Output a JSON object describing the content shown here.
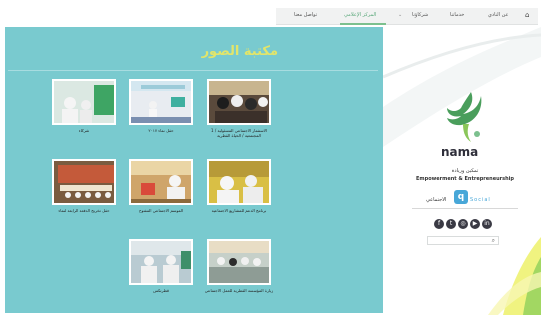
{
  "nav": {
    "home": "⌂",
    "items": [
      {
        "label": "عن النادي"
      },
      {
        "label": "خدماتنا"
      },
      {
        "label": "شركاؤنا"
      },
      {
        "label": "⌄"
      },
      {
        "label": "المركز الإعلامي"
      },
      {
        "label": "تواصل معنا"
      }
    ]
  },
  "main": {
    "title": "مكتبة الصور",
    "cards": [
      {
        "caption": "1 / الاستثمار الاجتماعي المسئولية المجتمعية / الحياة القطرية"
      },
      {
        "caption": "حفل نماء ٢٠١٧"
      },
      {
        "caption": "شركاء"
      },
      {
        "caption": "برنامج الدعم للمشاريع الاجتماعية"
      },
      {
        "caption": "الموسم الاجتماعي المفتوح"
      },
      {
        "caption": "حفل تخريج الدفعة الرابعة لنماء"
      },
      {
        "caption": "زيارة المؤسسة القطرية للعمل الاجتماعي"
      },
      {
        "caption": "قطرتكس"
      }
    ]
  },
  "sidebar": {
    "brand": "nama",
    "tagline_ar": "تمكين وريادة",
    "tagline_en": "Empowerment & Entrepreneurship",
    "social_ar": "الاجتماعي",
    "social_en": "Social",
    "social_icons": [
      "f",
      "t",
      "◎",
      "▶",
      "in"
    ],
    "search_placeholder": ""
  },
  "colors": {
    "panel": "#79cacf",
    "accent": "#e2e56a",
    "brand_green": "#5aa97b"
  }
}
